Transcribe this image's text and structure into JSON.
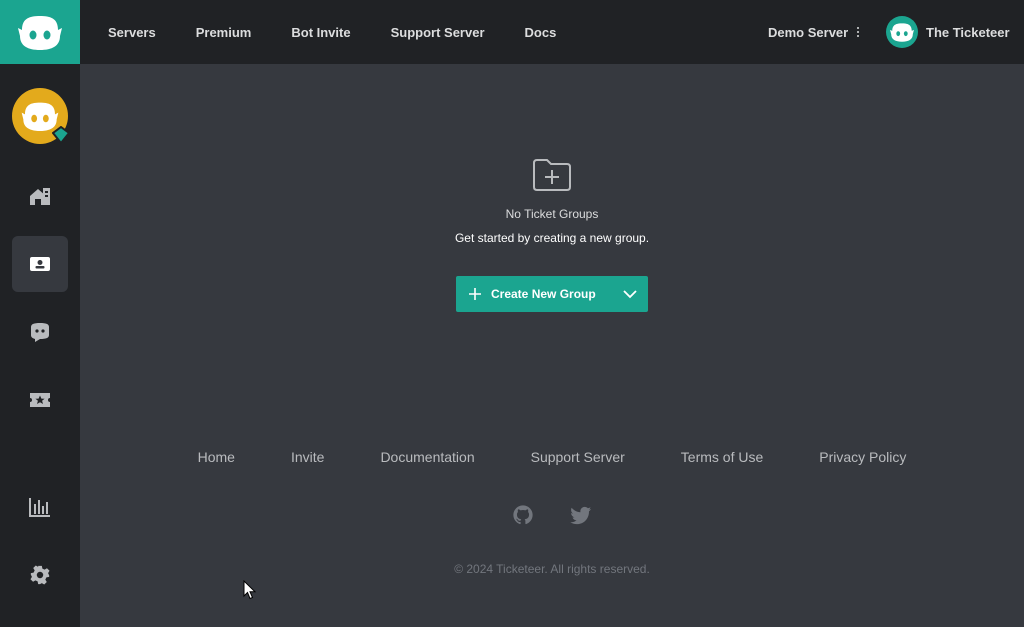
{
  "nav": {
    "items": [
      {
        "label": "Servers"
      },
      {
        "label": "Premium"
      },
      {
        "label": "Bot Invite"
      },
      {
        "label": "Support Server"
      },
      {
        "label": "Docs"
      }
    ]
  },
  "server_select": {
    "label": "Demo Server"
  },
  "user": {
    "name": "The Ticketeer"
  },
  "sidebar": {
    "items": [
      {
        "icon": "home-icon"
      },
      {
        "icon": "ticket-icon",
        "active": true
      },
      {
        "icon": "chat-icon"
      },
      {
        "icon": "star-ticket-icon"
      },
      {
        "icon": "stats-icon"
      },
      {
        "icon": "gear-icon"
      }
    ]
  },
  "empty_state": {
    "icon": "folder-plus-icon",
    "title": "No Ticket Groups",
    "subtitle": "Get started by creating a new group."
  },
  "create_button": {
    "label": "Create New Group"
  },
  "footer": {
    "links": [
      {
        "label": "Home"
      },
      {
        "label": "Invite"
      },
      {
        "label": "Documentation"
      },
      {
        "label": "Support Server"
      },
      {
        "label": "Terms of Use"
      },
      {
        "label": "Privacy Policy"
      }
    ],
    "socials": [
      "github-icon",
      "twitter-icon"
    ],
    "copyright": "© 2024 Ticketeer. All rights reserved."
  },
  "colors": {
    "accent": "#1ba590",
    "topbar": "#202225",
    "background": "#36393f",
    "server_avatar": "#e3aa1c"
  }
}
